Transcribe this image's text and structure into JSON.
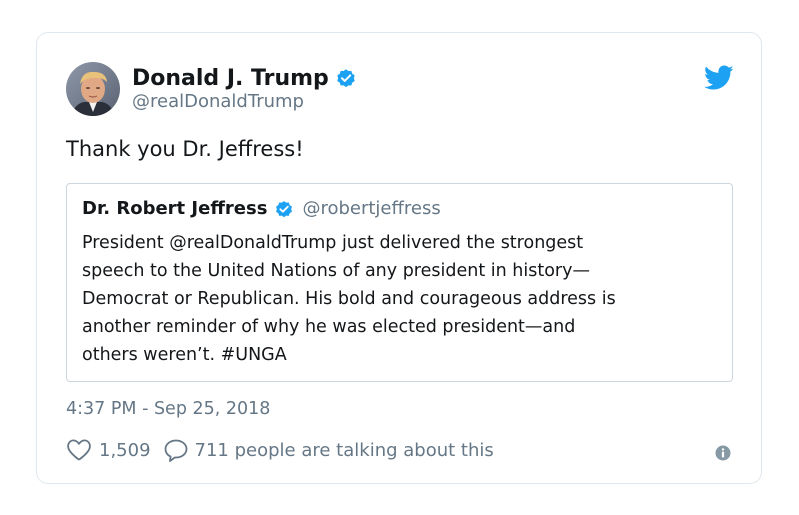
{
  "tweet": {
    "author": {
      "display_name": "Donald J. Trump",
      "handle": "@realDonaldTrump",
      "verified": true
    },
    "text": "Thank you Dr. Jeffress!",
    "quoted": {
      "author_name": "Dr. Robert Jeffress",
      "handle": "@robertjeffress",
      "verified": true,
      "lines": [
        "President @realDonaldTrump just delivered the strongest",
        "speech to the United Nations of any president in history—",
        "Democrat or Republican. His bold and courageous address is",
        "another reminder of why he was elected president—and",
        "others weren’t. #UNGA"
      ]
    },
    "timestamp": "4:37 PM - Sep 25, 2018",
    "likes": "1,509",
    "talking": "711 people are talking about this"
  },
  "icons": {
    "verified": "verified-badge-icon",
    "brand": "twitter-bird-icon",
    "like": "heart-icon",
    "reply": "speech-bubble-icon",
    "info": "info-icon"
  },
  "colors": {
    "brand_blue": "#1da1f2",
    "text": "#14171a",
    "secondary": "#657786",
    "border": "#e1e8ed",
    "quote_border": "#ccd6dd",
    "info_gray": "#8899a6"
  }
}
